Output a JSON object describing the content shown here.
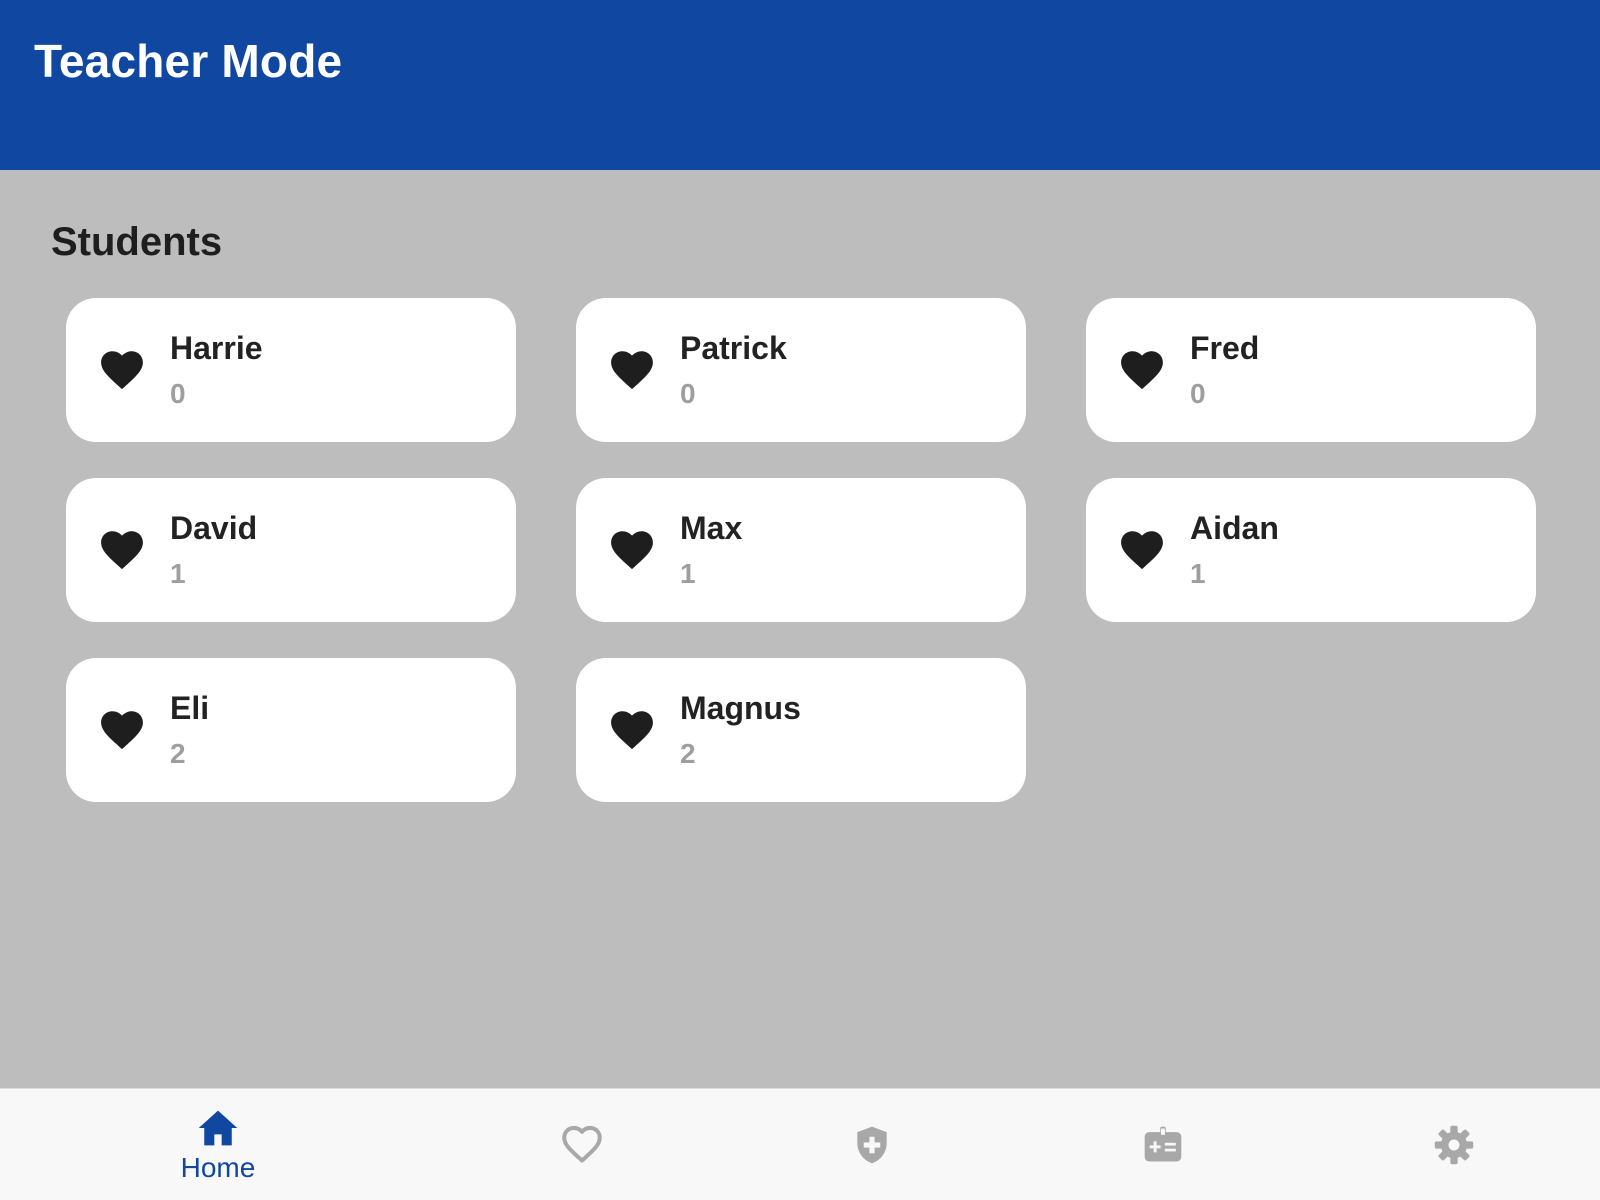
{
  "header": {
    "title": "Teacher Mode"
  },
  "main": {
    "section_title": "Students",
    "students": [
      {
        "name": "Harrie",
        "count": "0"
      },
      {
        "name": "Patrick",
        "count": "0"
      },
      {
        "name": "Fred",
        "count": "0"
      },
      {
        "name": "David",
        "count": "1"
      },
      {
        "name": "Max",
        "count": "1"
      },
      {
        "name": "Aidan",
        "count": "1"
      },
      {
        "name": "Eli",
        "count": "2"
      },
      {
        "name": "Magnus",
        "count": "2"
      }
    ]
  },
  "tabbar": {
    "tabs": [
      {
        "label": "Home",
        "icon": "home-icon",
        "active": true
      },
      {
        "label": "",
        "icon": "heart-outline-icon",
        "active": false
      },
      {
        "label": "",
        "icon": "shield-plus-icon",
        "active": false
      },
      {
        "label": "",
        "icon": "medical-id-icon",
        "active": false
      },
      {
        "label": "",
        "icon": "gear-icon",
        "active": false
      }
    ]
  },
  "colors": {
    "header_bg": "#0f47a1",
    "content_bg": "#bdbdbd",
    "card_bg": "#ffffff",
    "active_tab": "#0f47a1",
    "inactive_tab": "#a8a8a8",
    "count_text": "#9e9e9e"
  }
}
